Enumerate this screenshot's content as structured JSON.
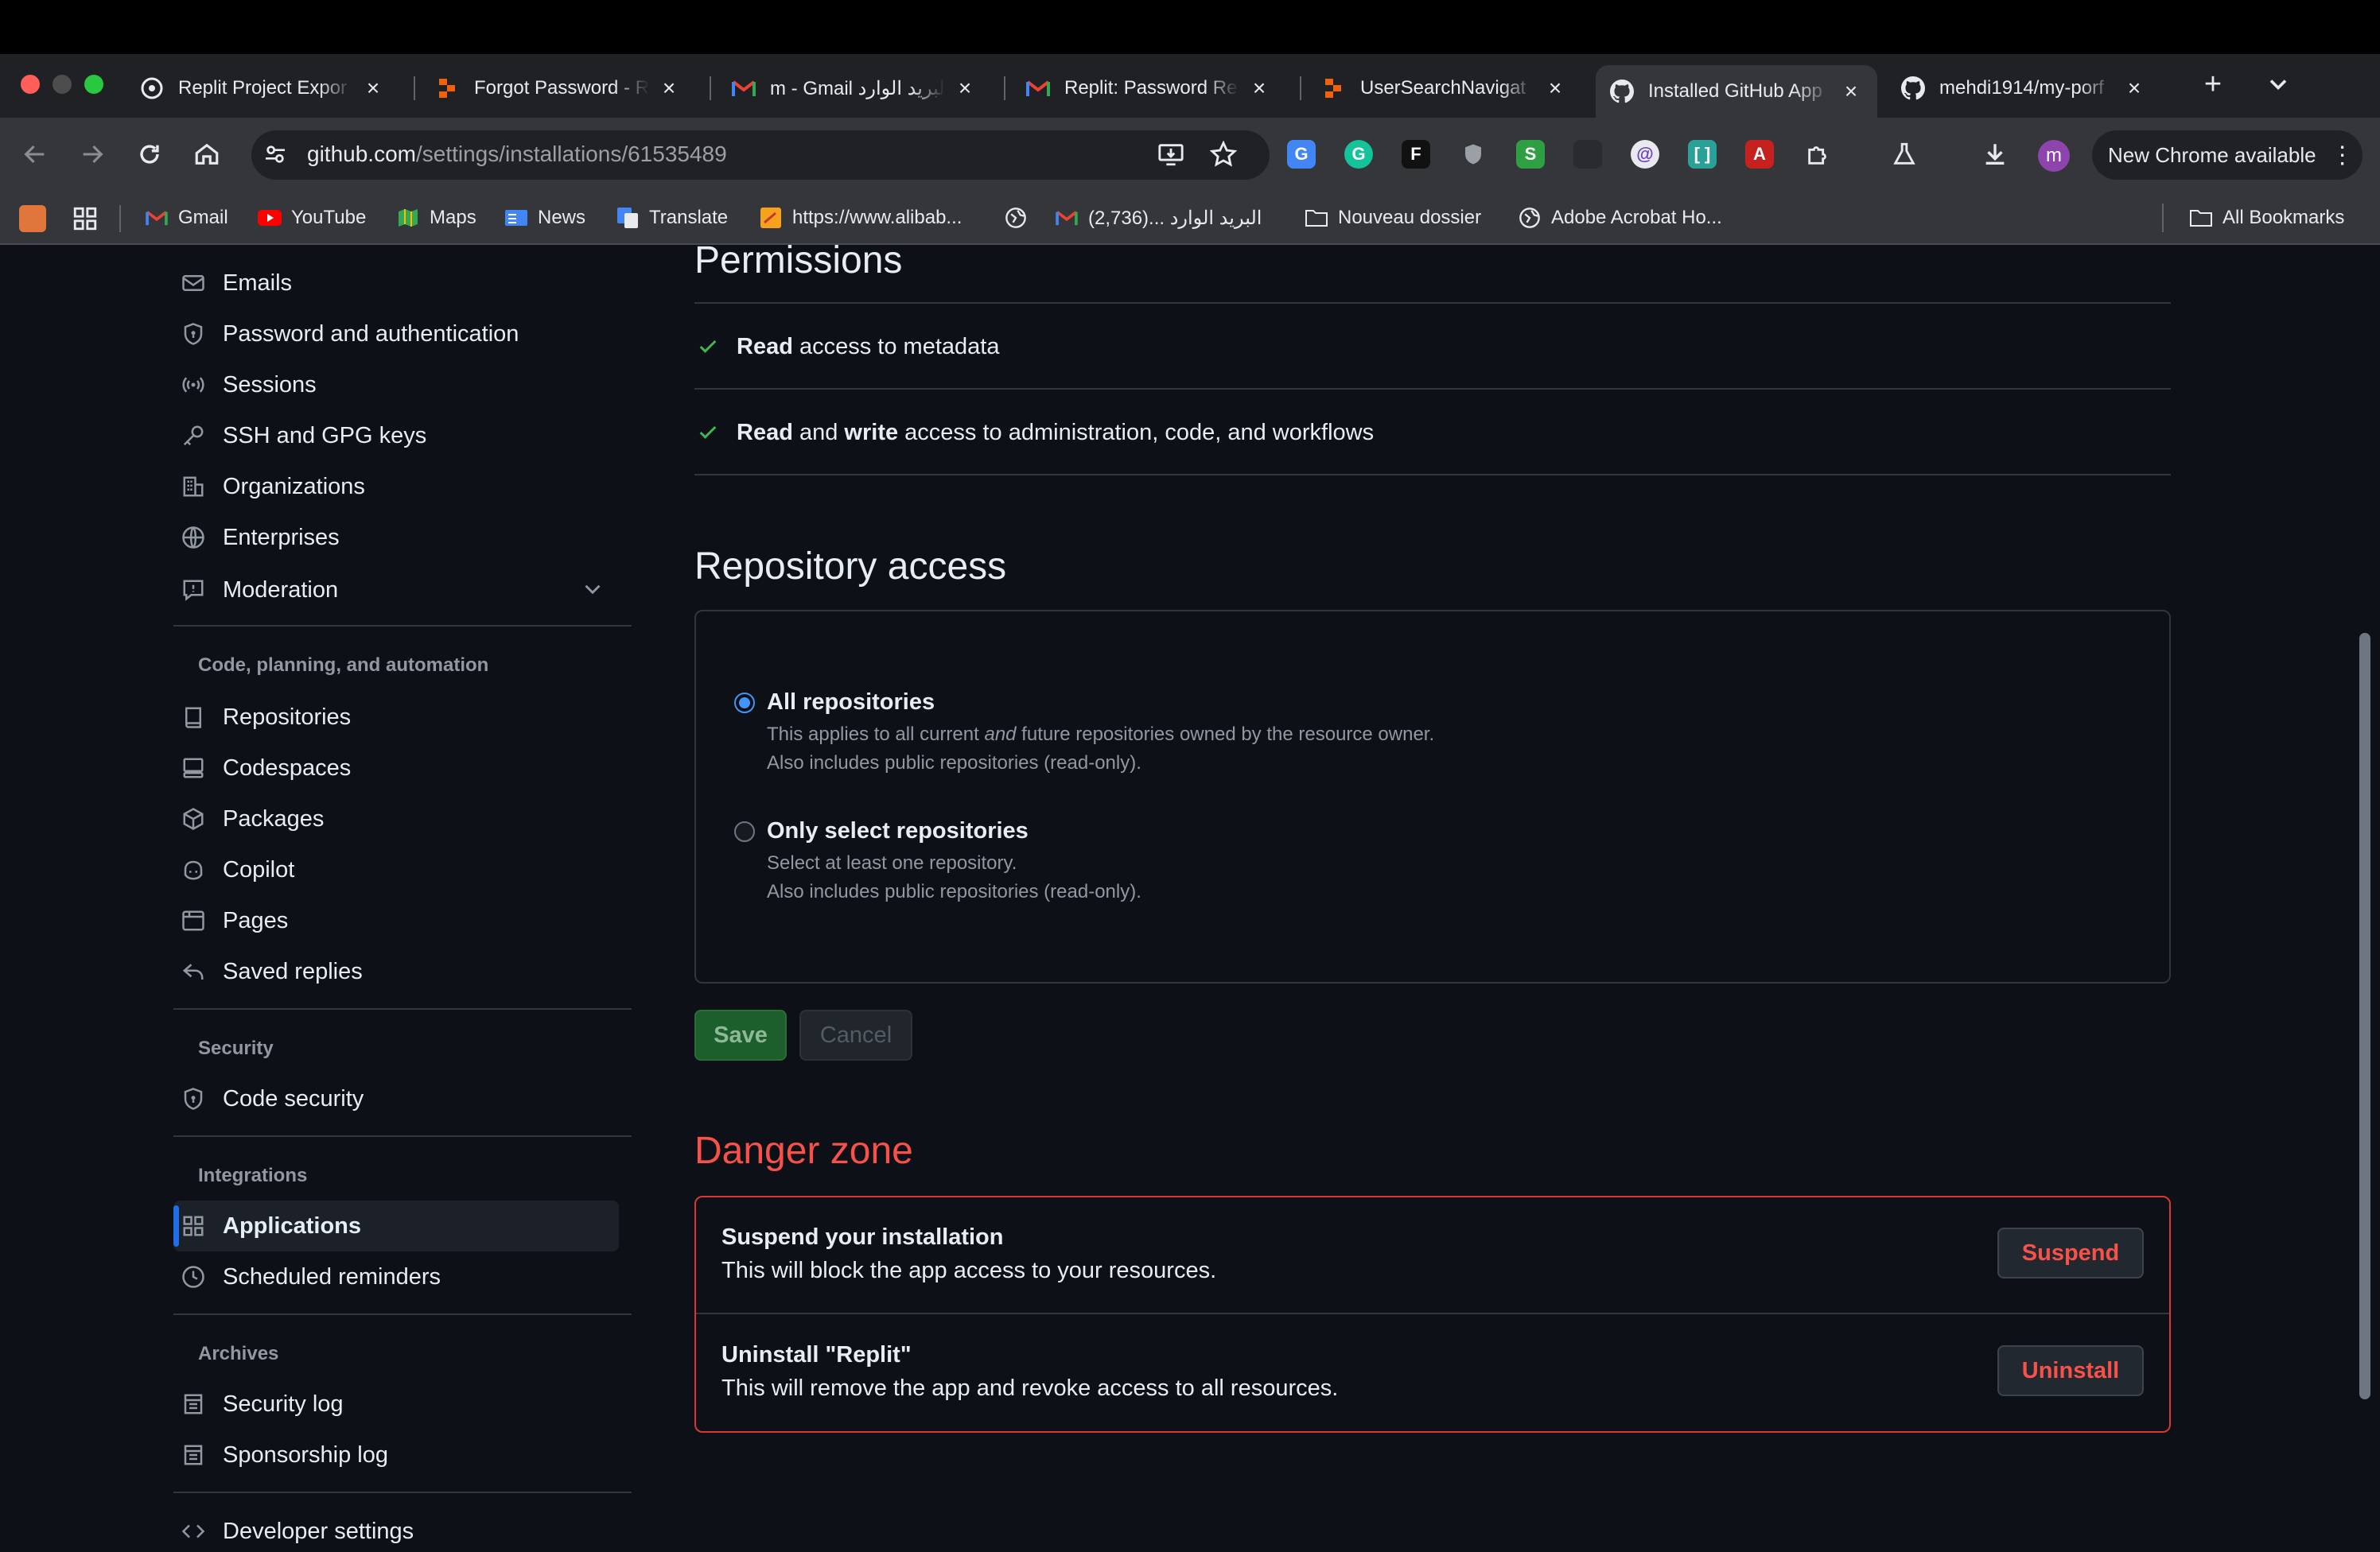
{
  "browser": {
    "tabs": [
      {
        "title": "Replit Project Expor",
        "icon": "replit-icon"
      },
      {
        "title": "Forgot Password - R",
        "icon": "replit-orange-icon"
      },
      {
        "title": "m - Gmail البريد الوارد",
        "icon": "gmail-icon"
      },
      {
        "title": "Replit: Password Re",
        "icon": "gmail-icon"
      },
      {
        "title": "UserSearchNavigat",
        "icon": "replit-orange-icon"
      },
      {
        "title": "Installed GitHub App",
        "icon": "github-icon",
        "active": true
      },
      {
        "title": "mehdi1914/my-porf",
        "icon": "github-icon"
      }
    ],
    "new_tab": "+",
    "tab_search": "chevron-down-icon",
    "url_host": "github.com",
    "url_path": "/settings/installations/61535489",
    "profile_initial": "m",
    "chrome_update": "New Chrome available",
    "bookmarks": [
      {
        "label": "Gmail",
        "icon": "gmail-icon"
      },
      {
        "label": "YouTube",
        "icon": "youtube-icon"
      },
      {
        "label": "Maps",
        "icon": "maps-icon"
      },
      {
        "label": "News",
        "icon": "news-icon"
      },
      {
        "label": "Translate",
        "icon": "translate-icon"
      },
      {
        "label": "https://www.alibab...",
        "icon": "alibaba-icon"
      },
      {
        "label": "(2,736)... البريد الوارد",
        "icon": "gmail-icon"
      },
      {
        "label": "Nouveau dossier",
        "icon": "folder-icon"
      },
      {
        "label": "Adobe Acrobat Ho...",
        "icon": "globe-icon"
      }
    ],
    "all_bookmarks": "All Bookmarks"
  },
  "sidebar": {
    "access_items": [
      {
        "label": "Emails",
        "icon": "mail-icon"
      },
      {
        "label": "Password and authentication",
        "icon": "shield-lock-icon"
      },
      {
        "label": "Sessions",
        "icon": "broadcast-icon"
      },
      {
        "label": "SSH and GPG keys",
        "icon": "key-icon"
      },
      {
        "label": "Organizations",
        "icon": "organization-icon"
      },
      {
        "label": "Enterprises",
        "icon": "globe-icon"
      },
      {
        "label": "Moderation",
        "icon": "report-icon"
      }
    ],
    "code_heading": "Code, planning, and automation",
    "code_items": [
      {
        "label": "Repositories",
        "icon": "repo-icon"
      },
      {
        "label": "Codespaces",
        "icon": "codespaces-icon"
      },
      {
        "label": "Packages",
        "icon": "package-icon"
      },
      {
        "label": "Copilot",
        "icon": "copilot-icon"
      },
      {
        "label": "Pages",
        "icon": "browser-icon"
      },
      {
        "label": "Saved replies",
        "icon": "reply-icon"
      }
    ],
    "security_heading": "Security",
    "security_items": [
      {
        "label": "Code security",
        "icon": "shield-lock-icon"
      }
    ],
    "integrations_heading": "Integrations",
    "integrations_items": [
      {
        "label": "Applications",
        "icon": "apps-icon",
        "active": true
      },
      {
        "label": "Scheduled reminders",
        "icon": "clock-icon"
      }
    ],
    "archives_heading": "Archives",
    "archives_items": [
      {
        "label": "Security log",
        "icon": "log-icon"
      },
      {
        "label": "Sponsorship log",
        "icon": "log-icon"
      }
    ],
    "developer_settings": "Developer settings"
  },
  "main": {
    "permissions_title": "Permissions",
    "permissions": [
      {
        "strong1": "Read",
        "middle": "",
        "strong2": "",
        "rest": " access to metadata"
      },
      {
        "strong1": "Read",
        "middle": " and ",
        "strong2": "write",
        "rest": " access to administration, code, and workflows"
      }
    ],
    "repo_access_title": "Repository access",
    "options": [
      {
        "title": "All repositories",
        "desc_before": "This applies to all current ",
        "desc_em": "and",
        "desc_after": " future repositories owned by the resource owner.",
        "desc2": "Also includes public repositories (read-only).",
        "selected": true
      },
      {
        "title": "Only select repositories",
        "desc1": "Select at least one repository.",
        "desc2": "Also includes public repositories (read-only).",
        "selected": false
      }
    ],
    "save_label": "Save",
    "cancel_label": "Cancel",
    "danger_title": "Danger zone",
    "danger_items": [
      {
        "title": "Suspend your installation",
        "desc": "This will block the app access to your resources.",
        "button": "Suspend"
      },
      {
        "title": "Uninstall \"Replit\"",
        "desc": "This will remove the app and revoke access to all resources.",
        "button": "Uninstall"
      }
    ]
  },
  "colors": {
    "bg": "#0d1117",
    "danger": "#f85149",
    "success_btn": "#238636",
    "accent_blue": "#1f6feb",
    "check_green": "#3fb950"
  }
}
